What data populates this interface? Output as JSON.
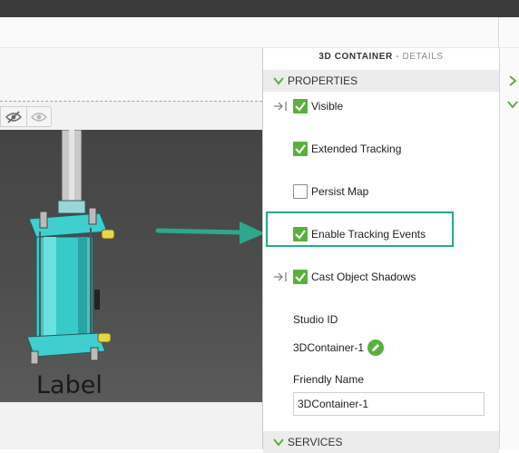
{
  "panel": {
    "title_main": "3D CONTAINER",
    "title_sep": " - ",
    "title_sub": "DETAILS",
    "properties_label": "PROPERTIES",
    "services_label": "SERVICES",
    "checkboxes": [
      {
        "label": "Visible",
        "checked": true
      },
      {
        "label": "Extended Tracking",
        "checked": true
      },
      {
        "label": "Persist Map",
        "checked": false
      },
      {
        "label": "Enable Tracking Events",
        "checked": true
      },
      {
        "label": "Cast Object Shadows",
        "checked": true
      }
    ],
    "studio_id_label": "Studio ID",
    "studio_id_value": "3DContainer-1",
    "friendly_name_label": "Friendly Name",
    "friendly_name_value": "3DContainer-1"
  },
  "canvas": {
    "label_text": "Label"
  },
  "colors": {
    "accent_green": "#5ab03c",
    "highlight_teal": "#2aa98d",
    "model_cyan": "#38c9c9"
  },
  "icons": [
    "hide-icon",
    "eye-icon",
    "binding-arrow-icon",
    "pencil-icon",
    "chevron-down-icon",
    "chevron-right-icon"
  ]
}
